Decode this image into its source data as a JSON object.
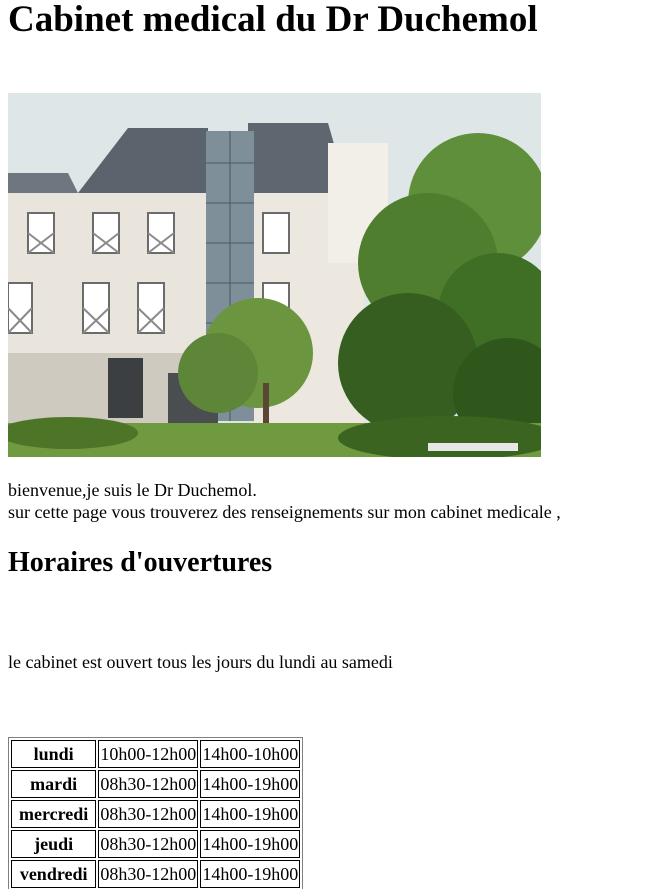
{
  "page": {
    "title": "Cabinet medical du Dr Duchemol",
    "photo_alt": "immeuble du cabinet medical",
    "intro_line1": "bienvenue,je suis le Dr Duchemol.",
    "intro_line2": "sur cette page vous trouverez des renseignements sur mon cabinet medicale ,",
    "hours_heading": "Horaires d'ouvertures",
    "open_note": "le cabinet est ouvert tous les jours du lundi au samedi"
  },
  "hours": [
    {
      "day": "lundi",
      "morning": "10h00-12h00",
      "afternoon": "14h00-10h00"
    },
    {
      "day": "mardi",
      "morning": "08h30-12h00",
      "afternoon": "14h00-19h00"
    },
    {
      "day": "mercredi",
      "morning": "08h30-12h00",
      "afternoon": "14h00-19h00"
    },
    {
      "day": "jeudi",
      "morning": "08h30-12h00",
      "afternoon": "14h00-19h00"
    },
    {
      "day": "vendredi",
      "morning": "08h30-12h00",
      "afternoon": "14h00-19h00"
    }
  ]
}
